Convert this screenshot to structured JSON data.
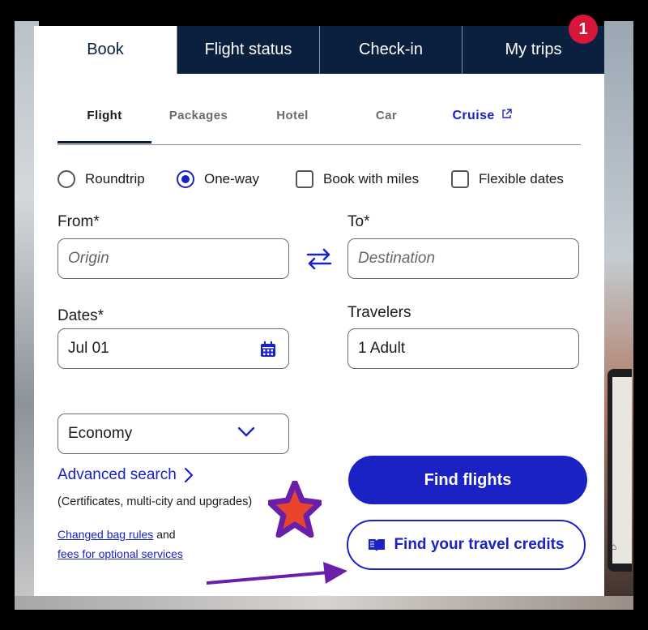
{
  "tabs": [
    {
      "label": "Book",
      "active": true
    },
    {
      "label": "Flight status",
      "active": false
    },
    {
      "label": "Check-in",
      "active": false
    },
    {
      "label": "My trips",
      "active": false
    }
  ],
  "badge": {
    "count": "1",
    "color": "#d6173b"
  },
  "subtabs": [
    {
      "label": "Flight",
      "active": true
    },
    {
      "label": "Packages"
    },
    {
      "label": "Hotel"
    },
    {
      "label": "Car"
    },
    {
      "label": "Cruise",
      "icon": "external-link-icon"
    }
  ],
  "trip_options": {
    "roundtrip": "Roundtrip",
    "oneway": "One-way",
    "selected": "One-way",
    "miles": "Book with miles",
    "flexible": "Flexible dates"
  },
  "form": {
    "from_label": "From*",
    "from_placeholder": "Origin",
    "to_label": "To*",
    "to_placeholder": "Destination",
    "swap_icon": "swap-arrows-icon",
    "dates_label": "Dates*",
    "dates_value": "Jul 01",
    "calendar_icon": "calendar-icon",
    "travelers_label": "Travelers",
    "travelers_value": "1 Adult",
    "cabin_value": "Economy"
  },
  "links": {
    "advanced": "Advanced search",
    "advanced_sub": "(Certificates, multi-city and upgrades)",
    "bag_rules": "Changed bag rules",
    "and": "and",
    "fees": "fees for optional services"
  },
  "buttons": {
    "find_flights": "Find flights",
    "travel_credits": "Find your travel credits"
  },
  "colors": {
    "navy": "#0b1f3f",
    "accent": "#1a22c4",
    "annotation_purple": "#6a1fa8",
    "annotation_star_fill": "#e8452c"
  }
}
